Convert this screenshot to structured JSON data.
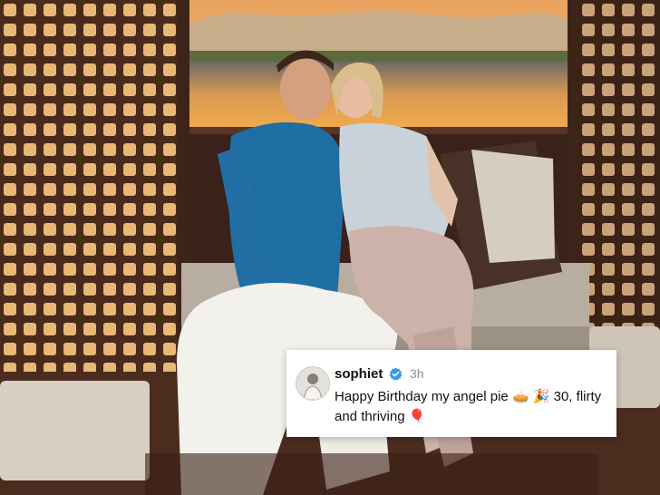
{
  "comment": {
    "username": "sophiet",
    "time": "3h",
    "text": "Happy Birthday my angel pie 🥧 🎉 30, flirty and thriving 🎈"
  },
  "icons": {
    "verified": "verified-badge-icon",
    "avatar": "profile-avatar"
  },
  "colors": {
    "verified_blue": "#3897f0",
    "sunset_sky": "#f2a65a",
    "teal_shirt": "#1f6ea3"
  }
}
